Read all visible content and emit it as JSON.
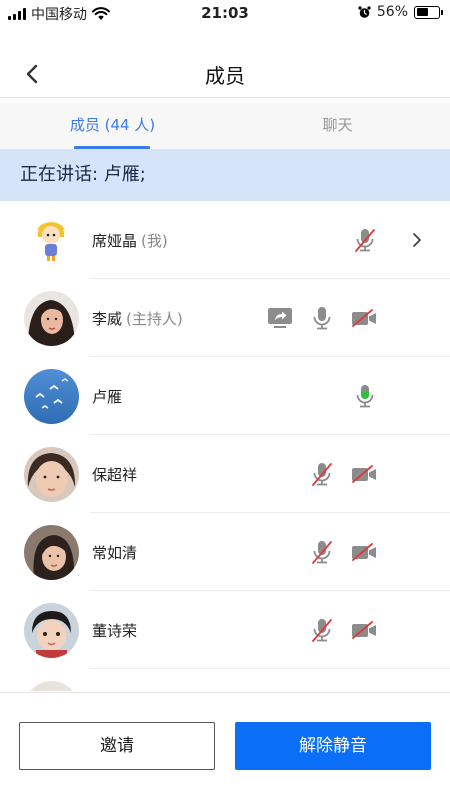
{
  "status_bar": {
    "carrier": "中国移动",
    "time": "21:03",
    "battery_text": "56%",
    "battery_level": 0.56,
    "icons": [
      "signal-icon",
      "wifi-icon",
      "alarm-icon",
      "battery-icon"
    ]
  },
  "nav": {
    "title": "成员",
    "back_icon": "chevron-left-icon"
  },
  "tabs": [
    {
      "label": "成员 (44 人)",
      "active": true
    },
    {
      "label": "聊天",
      "active": false
    }
  ],
  "speaking": {
    "text": "正在讲话: 卢雁;"
  },
  "members": [
    {
      "name": "席娅晶",
      "role": "(我)",
      "mic": "muted",
      "camera": "none",
      "share": false,
      "chevron": true
    },
    {
      "name": "李威",
      "role": "(主持人)",
      "mic": "on",
      "camera": "off",
      "share": true,
      "chevron": false
    },
    {
      "name": "卢雁",
      "role": "",
      "mic": "speaking",
      "camera": "none",
      "share": false,
      "chevron": false
    },
    {
      "name": "保超祥",
      "role": "",
      "mic": "muted",
      "camera": "off",
      "share": false,
      "chevron": false
    },
    {
      "name": "常如清",
      "role": "",
      "mic": "muted",
      "camera": "off",
      "share": false,
      "chevron": false
    },
    {
      "name": "董诗荣",
      "role": "",
      "mic": "muted",
      "camera": "off",
      "share": false,
      "chevron": false
    }
  ],
  "actions": {
    "invite_label": "邀请",
    "unmute_label": "解除静音"
  },
  "colors": {
    "accent": "#3b7bea",
    "banner_bg": "#d5e4f9",
    "primary_button": "#0b6ef6",
    "mic_active": "#2ec43a",
    "muted_slash": "#e0383e",
    "icon_gray": "#8c8c8c"
  }
}
